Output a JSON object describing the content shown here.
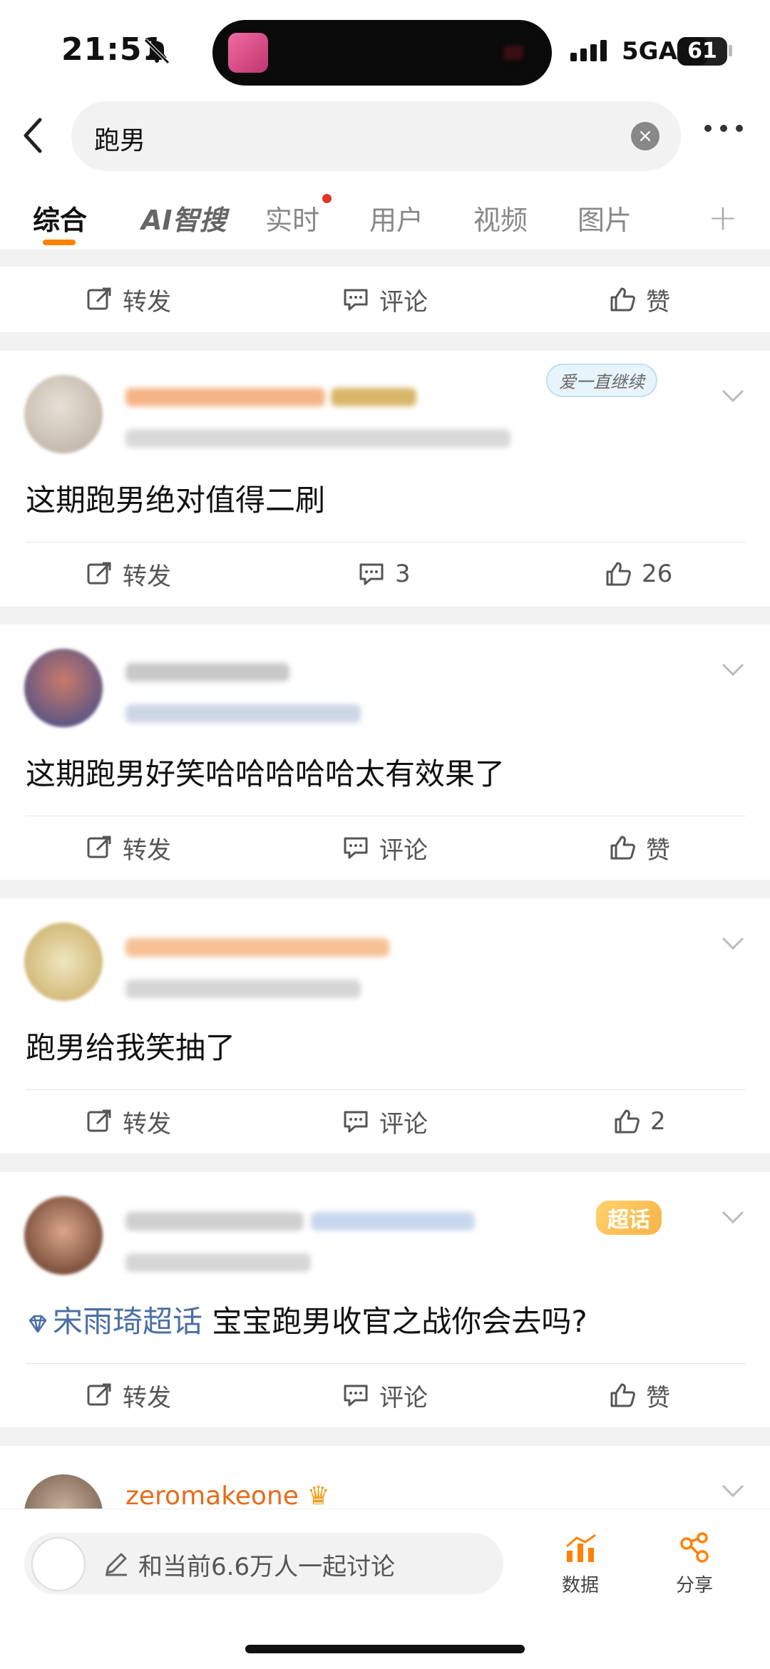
{
  "status": {
    "time": "21:51",
    "network": "5GA",
    "battery": "61",
    "battery_level": 0.61
  },
  "search": {
    "query": "跑男",
    "clear_glyph": "×"
  },
  "tabs": [
    "综合",
    "AI智搜",
    "实时",
    "用户",
    "视频",
    "图片"
  ],
  "actions": {
    "repost": "转发",
    "comment": "评论",
    "like": "赞"
  },
  "posts": [
    {
      "text": "",
      "comments": "",
      "likes": ""
    },
    {
      "text": "这期跑男绝对值得二刷",
      "comments": "3",
      "likes": "26",
      "badge_text": "爱一直继续"
    },
    {
      "text": "这期跑男好笑哈哈哈哈哈太有效果了",
      "comments": "",
      "likes": ""
    },
    {
      "text": "跑男给我笑抽了",
      "comments": "",
      "likes": "2"
    },
    {
      "topic": "宋雨琦超话",
      "text": " 宝宝跑男收官之战你会去吗?",
      "comments": "",
      "likes": "",
      "badge_text": "超话"
    },
    {
      "username": "zeromakeone",
      "crown": "♛"
    }
  ],
  "bottom": {
    "composer_placeholder": "和当前6.6万人一起讨论",
    "data_label": "数据",
    "share_label": "分享"
  },
  "colors": {
    "accent": "#ff8200",
    "link": "#4a6fa5",
    "username": "#e66b18",
    "divider": "#f2f2f2"
  },
  "icons": [
    "bell-mute-icon",
    "back-icon",
    "clear-icon",
    "more-icon",
    "plus-icon",
    "repost-icon",
    "comment-icon",
    "like-icon",
    "chevron-down-icon",
    "pen-icon",
    "data-icon",
    "share-icon",
    "supertopic-icon"
  ]
}
